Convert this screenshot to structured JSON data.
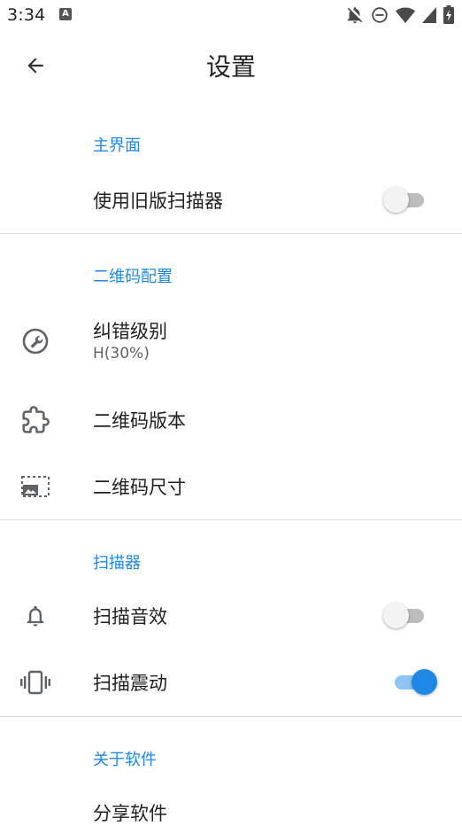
{
  "status_bar": {
    "time": "3:34",
    "app_icon_label": "A"
  },
  "app_bar": {
    "title": "设置"
  },
  "sections": {
    "main": {
      "header": "主界面",
      "legacy_scanner": {
        "title": "使用旧版扫描器",
        "enabled": false
      }
    },
    "qr_config": {
      "header": "二维码配置",
      "error_level": {
        "title": "纠错级别",
        "summary": "H(30%)",
        "icon": "wrench-icon"
      },
      "qr_version": {
        "title": "二维码版本",
        "icon": "puzzle-icon"
      },
      "qr_size": {
        "title": "二维码尺寸",
        "icon": "image-size-icon"
      }
    },
    "scanner": {
      "header": "扫描器",
      "scan_sound": {
        "title": "扫描音效",
        "enabled": false,
        "icon": "bell-icon"
      },
      "scan_vibrate": {
        "title": "扫描震动",
        "enabled": true,
        "icon": "vibrate-icon"
      }
    },
    "about": {
      "header": "关于软件",
      "share": {
        "title": "分享软件"
      }
    }
  },
  "colors": {
    "accent": "#1e88e5",
    "accent_track": "#8fc3f2",
    "text_primary": "#212121",
    "text_secondary": "#616161",
    "icon": "#5f6368"
  }
}
